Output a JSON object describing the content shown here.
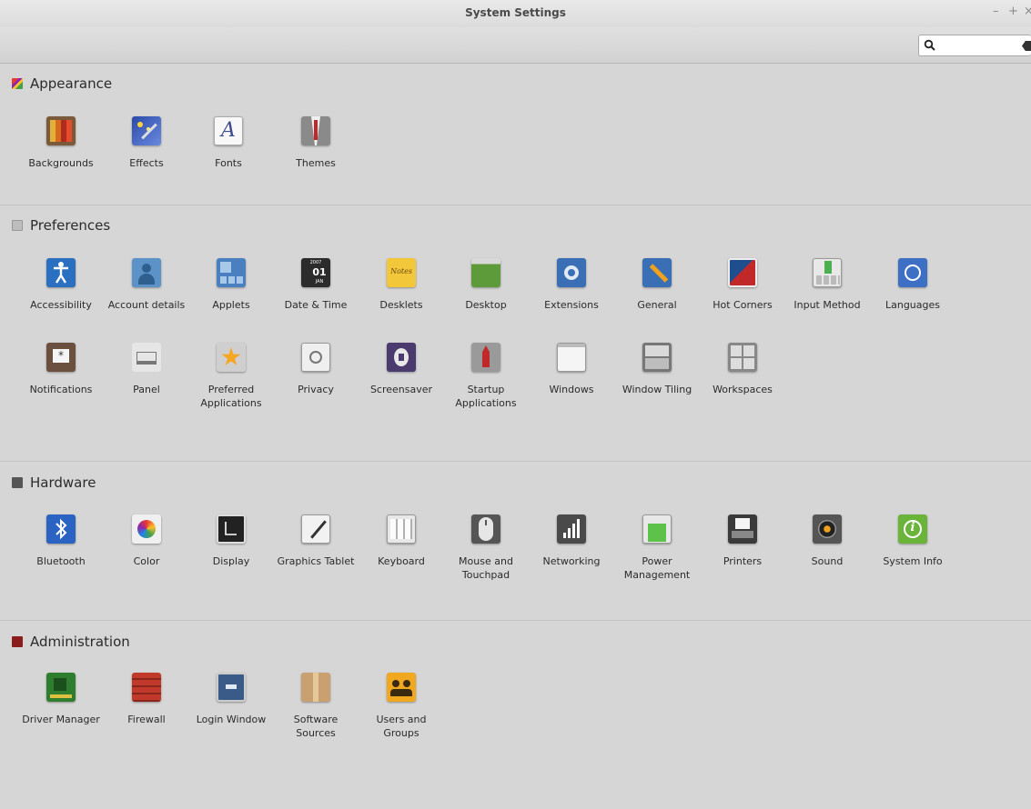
{
  "window": {
    "title": "System Settings",
    "minimize": "–",
    "maximize": "+",
    "close": "×"
  },
  "search": {
    "value": "",
    "placeholder": ""
  },
  "sections": {
    "appearance": {
      "title": "Appearance",
      "items": [
        "Backgrounds",
        "Effects",
        "Fonts",
        "Themes"
      ]
    },
    "preferences": {
      "title": "Preferences",
      "items": [
        "Accessibility",
        "Account details",
        "Applets",
        "Date & Time",
        "Desklets",
        "Desktop",
        "Extensions",
        "General",
        "Hot Corners",
        "Input Method",
        "Languages",
        "Notifications",
        "Panel",
        "Preferred Applications",
        "Privacy",
        "Screensaver",
        "Startup Applications",
        "Windows",
        "Window Tiling",
        "Workspaces"
      ]
    },
    "hardware": {
      "title": "Hardware",
      "items": [
        "Bluetooth",
        "Color",
        "Display",
        "Graphics Tablet",
        "Keyboard",
        "Mouse and Touchpad",
        "Networking",
        "Power Management",
        "Printers",
        "Sound",
        "System Info"
      ]
    },
    "administration": {
      "title": "Administration",
      "items": [
        "Driver Manager",
        "Firewall",
        "Login Window",
        "Software Sources",
        "Users and Groups"
      ]
    }
  },
  "icon_text": {
    "fonts": "A",
    "date_year": "2007",
    "date_day": "01",
    "date_month": "JAN",
    "desklets": "Notes"
  },
  "colors": {
    "background": "#d6d6d6",
    "divider": "#c4c4c4",
    "title_text": "#4a4a4a"
  }
}
